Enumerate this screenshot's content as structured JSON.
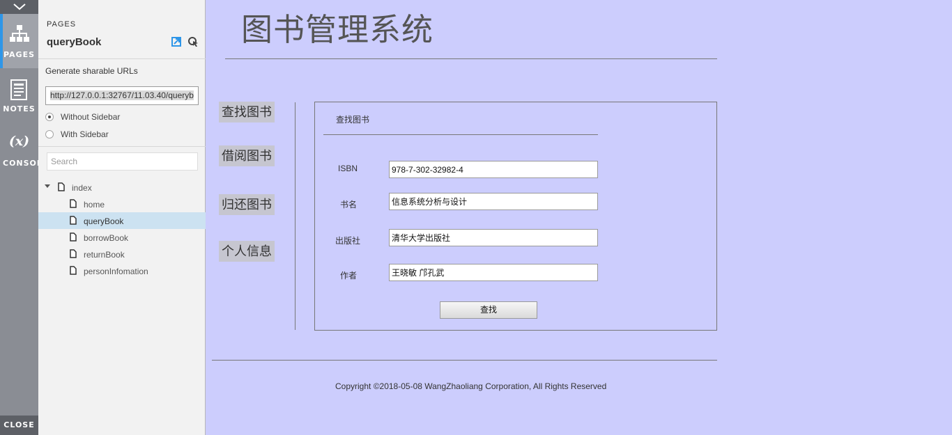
{
  "rail": {
    "pages_label": "PAGES",
    "notes_label": "NOTES",
    "console_symbol": "(x)",
    "console_label": "CONSOLE",
    "close_label": "CLOSE",
    "accent": "#2e96e8"
  },
  "panel": {
    "caption": "PAGES",
    "current_page": "queryBook",
    "share_caption": "Generate sharable URLs",
    "share_url": "http://127.0.0.1:32767/11.03.40/queryb",
    "options": [
      "Without Sidebar",
      "With Sidebar"
    ],
    "selected_option": "Without Sidebar",
    "search_placeholder": "Search",
    "tree": [
      {
        "label": "index",
        "level": 0,
        "expanded": true,
        "selected": false
      },
      {
        "label": "home",
        "level": 1,
        "selected": false
      },
      {
        "label": "queryBook",
        "level": 1,
        "selected": true
      },
      {
        "label": "borrowBook",
        "level": 1,
        "selected": false
      },
      {
        "label": "returnBook",
        "level": 1,
        "selected": false
      },
      {
        "label": "personInfomation",
        "level": 1,
        "selected": false
      }
    ]
  },
  "site": {
    "title": "图书管理系统",
    "nav": [
      "查找图书",
      "借阅图书",
      "归还图书",
      "个人信息"
    ],
    "form": {
      "heading": "查找图书",
      "fields": [
        {
          "label": "ISBN",
          "value": "978-7-302-32982-4"
        },
        {
          "label": "书名",
          "value": "信息系统分析与设计"
        },
        {
          "label": "出版社",
          "value": "清华大学出版社"
        },
        {
          "label": "作者",
          "value": "王晓敏 邝孔武"
        }
      ],
      "submit_label": "查找"
    },
    "copyright": "Copyright ©2018-05-08 WangZhaoliang Corporation, All Rights Reserved",
    "background": "#cccdfd"
  }
}
